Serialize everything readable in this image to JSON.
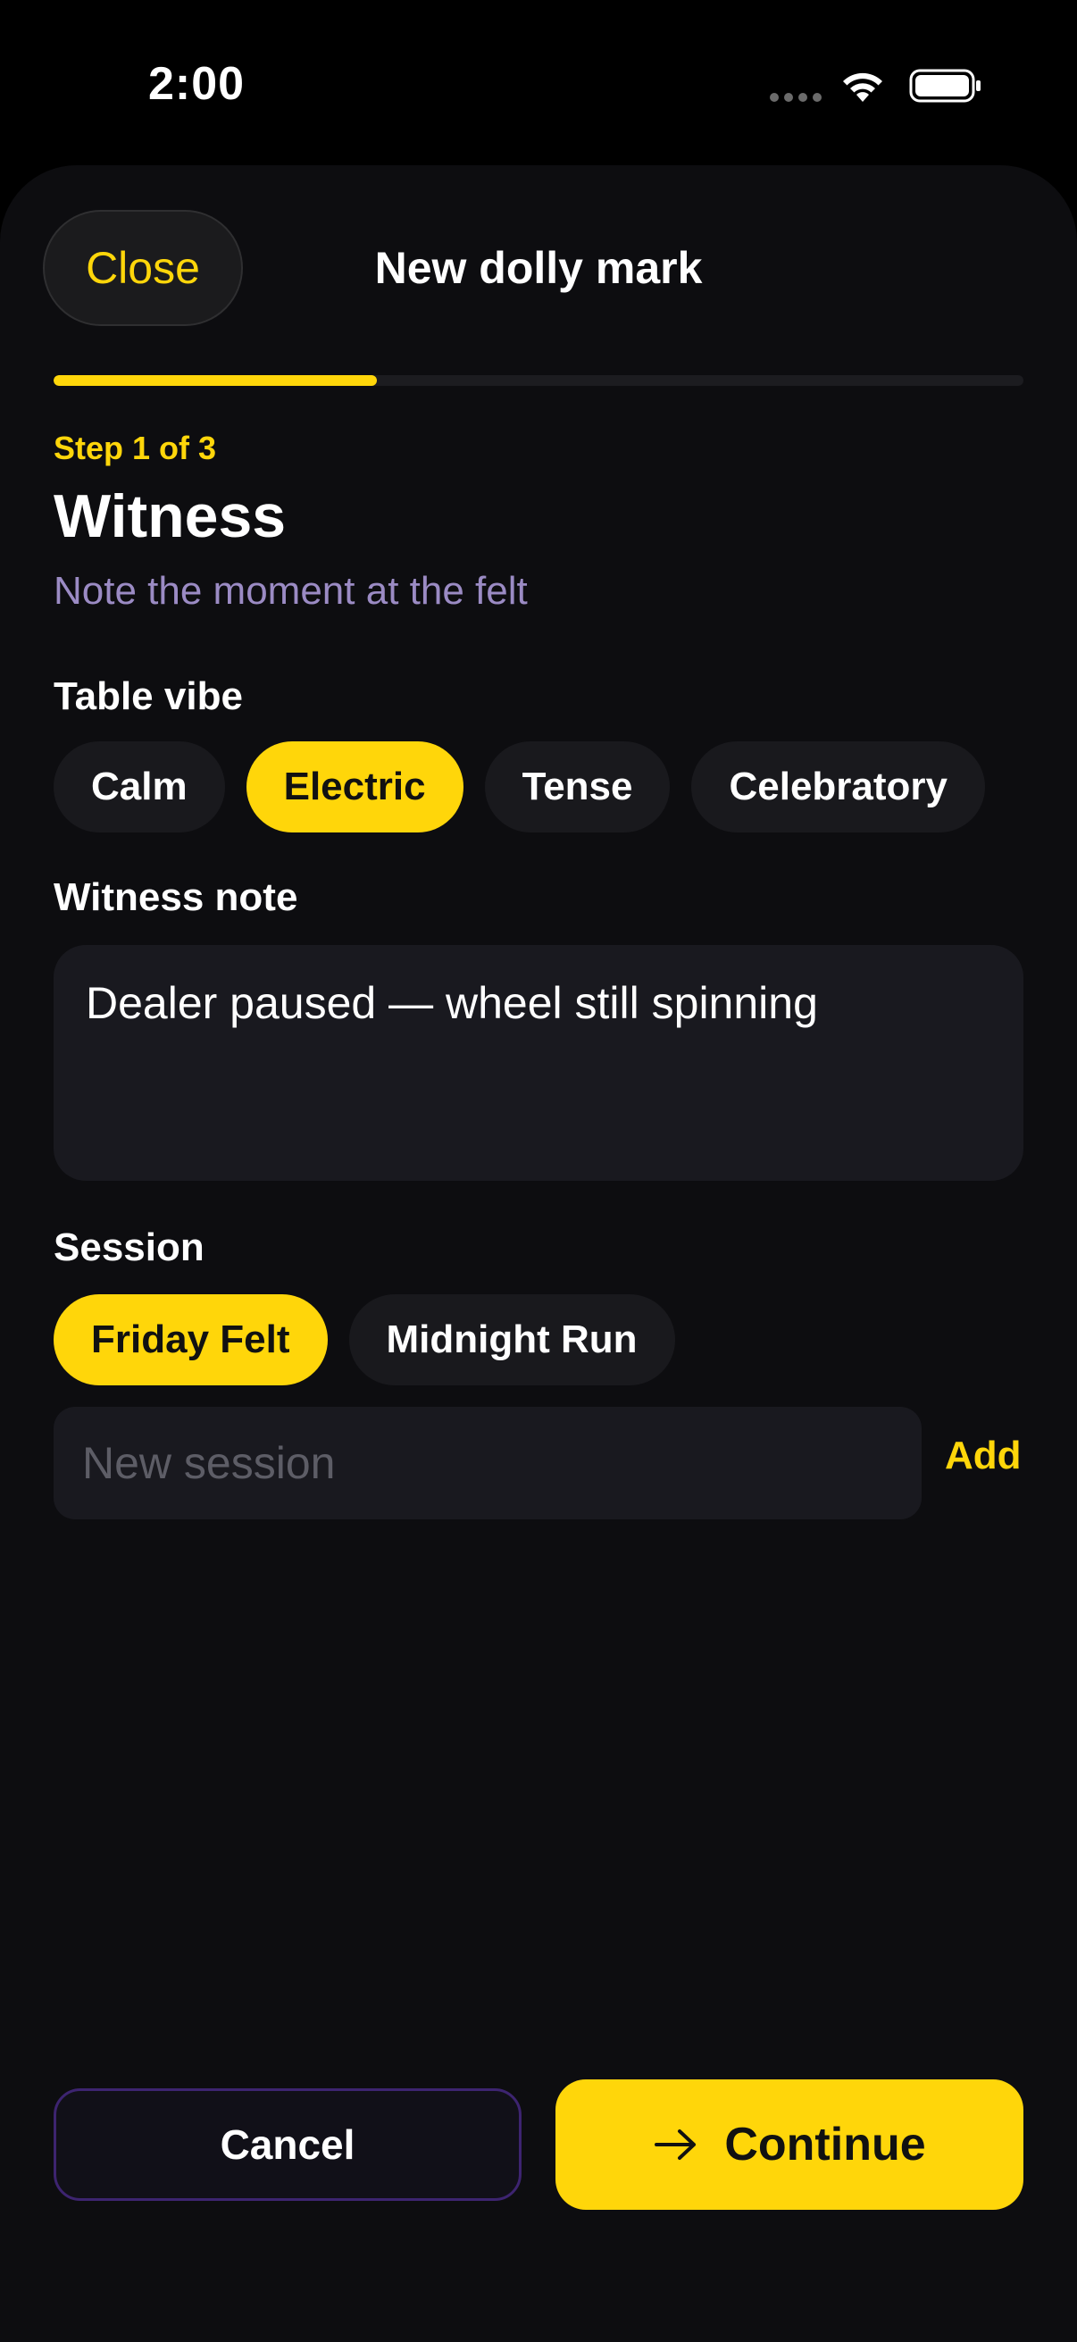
{
  "status_bar": {
    "time": "2:00",
    "icons": [
      "cellular-dots-icon",
      "wifi-icon",
      "battery-icon"
    ]
  },
  "header": {
    "close_label": "Close",
    "title": "New dolly mark"
  },
  "progress": {
    "current_step": 1,
    "total_steps": 3,
    "fraction": 0.333
  },
  "step": {
    "label": "Step 1 of 3",
    "title": "Witness",
    "subtitle": "Note the moment at the felt"
  },
  "table_vibe": {
    "label": "Table vibe",
    "options": [
      "Calm",
      "Electric",
      "Tense",
      "Celebratory"
    ],
    "selected": "Electric"
  },
  "witness_note": {
    "label": "Witness note",
    "value": "Dealer paused — wheel still spinning"
  },
  "session": {
    "label": "Session",
    "options": [
      "Friday Felt",
      "Midnight Run"
    ],
    "selected": "Friday Felt",
    "new_placeholder": "New session",
    "new_value": "",
    "add_label": "Add"
  },
  "footer": {
    "cancel_label": "Cancel",
    "continue_label": "Continue",
    "continue_icon": "arrow-right-icon"
  },
  "colors": {
    "accent": "#ffd60a",
    "background": "#0d0d10",
    "chip_bg": "#19191d",
    "subtitle": "#9b8bc4",
    "cancel_border": "#3d2470"
  }
}
